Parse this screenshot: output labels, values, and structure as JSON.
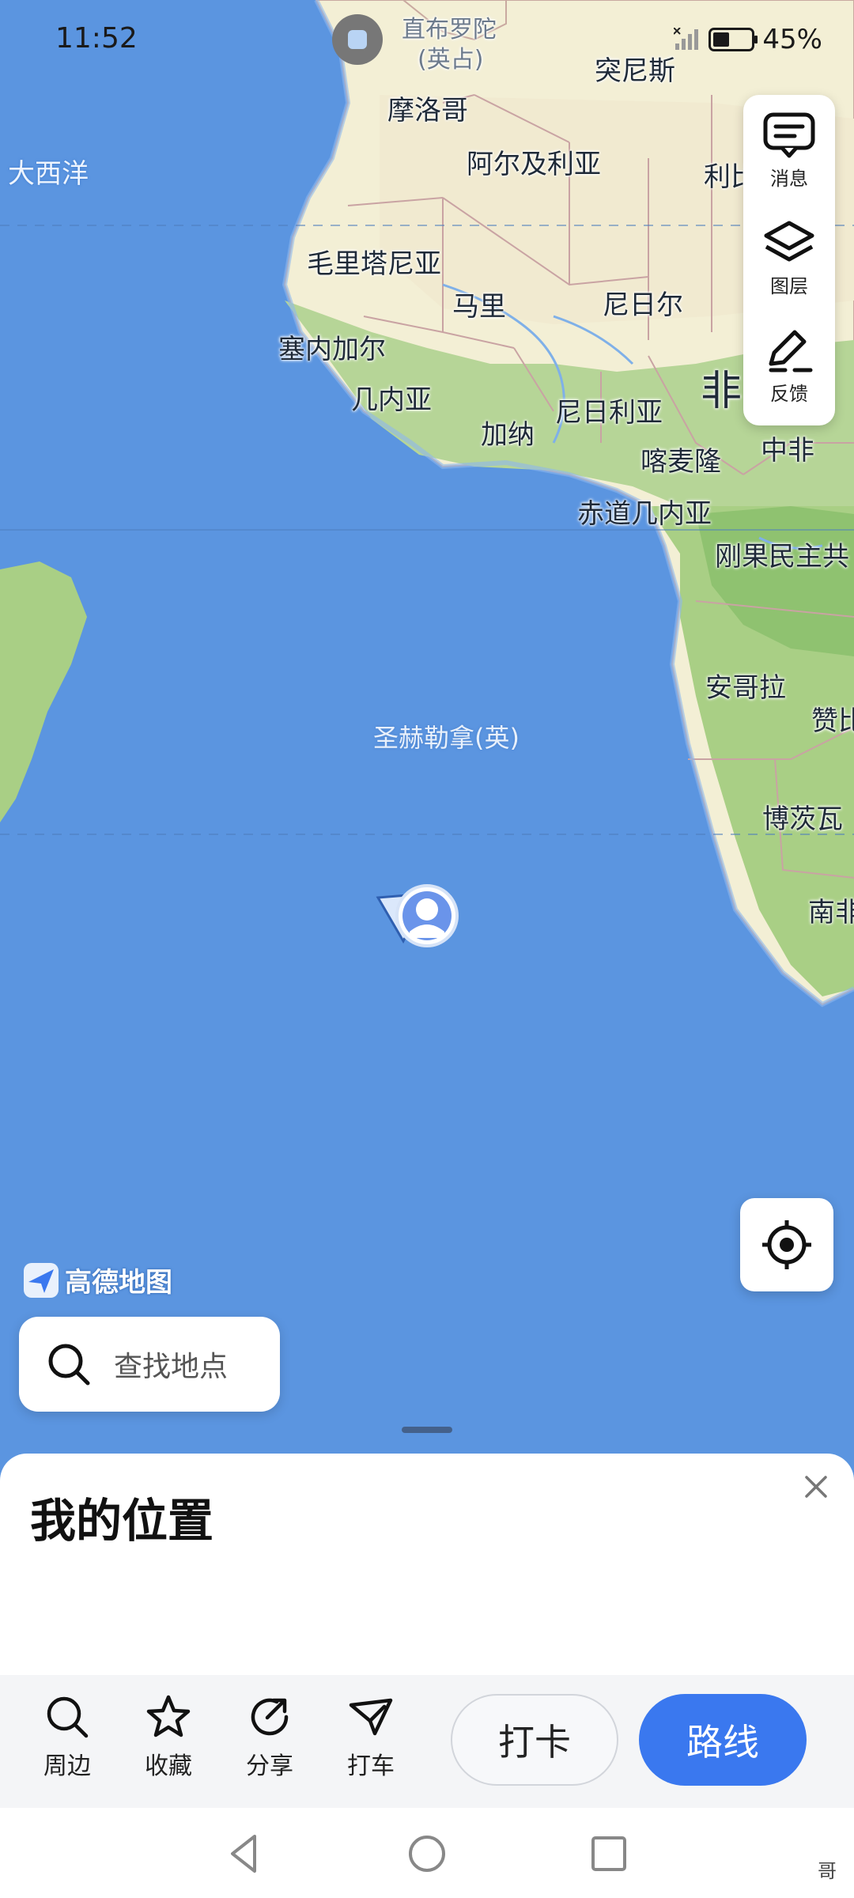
{
  "status_bar": {
    "time": "11:52",
    "battery_percent": "45%"
  },
  "map": {
    "labels": {
      "cairo": "直布罗陀",
      "cairo_sub": "(英占)",
      "tunisia": "突尼斯",
      "morocco": "摩洛哥",
      "atlantic": "大西洋",
      "algeria": "阿尔及利亚",
      "libya": "利比",
      "mauritania": "毛里塔尼亚",
      "mali": "马里",
      "niger": "尼日尔",
      "senegal": "塞内加尔",
      "guinea": "几内亚",
      "ghana": "加纳",
      "nigeria": "尼日利亚",
      "africa": "非",
      "cameroon": "喀麦隆",
      "car": "中非",
      "eq_guinea": "赤道几内亚",
      "drc": "刚果民主共",
      "angola": "安哥拉",
      "zambia": "赞比",
      "st_helena": "圣赫勒拿(英)",
      "botswana": "博茨瓦",
      "south_africa": "南非"
    }
  },
  "tools": {
    "messages_label": "消息",
    "layers_label": "图层",
    "feedback_label": "反馈"
  },
  "brand": {
    "name": "高德地图"
  },
  "search": {
    "placeholder": "查找地点"
  },
  "sheet": {
    "title": "我的位置"
  },
  "actions": {
    "nearby": "周边",
    "favorite": "收藏",
    "share": "分享",
    "taxi": "打车",
    "checkin": "打卡",
    "route": "路线"
  },
  "nav": {
    "extra": "哥"
  },
  "colors": {
    "ocean": "#5b95e0",
    "land": "#f3efd5",
    "green_land": "#a9d18e",
    "accent": "#3a78ef"
  }
}
